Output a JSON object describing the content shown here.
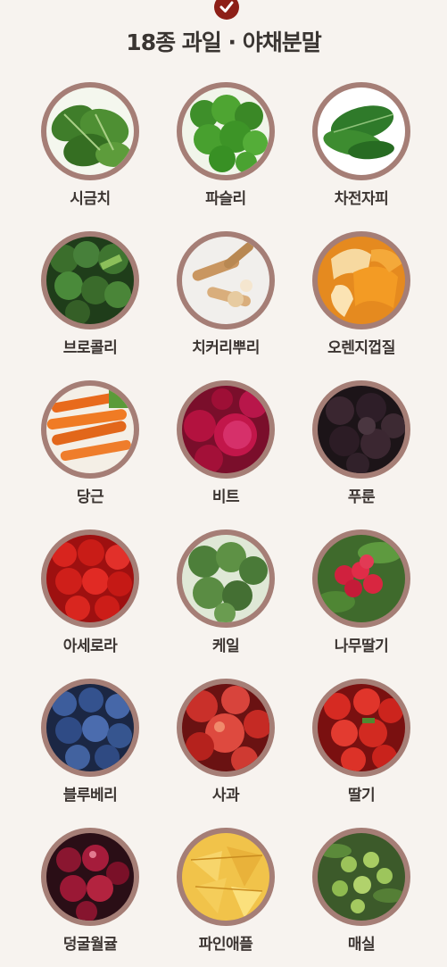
{
  "header": {
    "title": "18종 과일 · 야채분말",
    "check_icon": "check-circle-icon",
    "accent": "#8d1f17"
  },
  "items": [
    {
      "label": "시금치",
      "icon": "spinach-icon"
    },
    {
      "label": "파슬리",
      "icon": "parsley-icon"
    },
    {
      "label": "차전자피",
      "icon": "psyllium-icon"
    },
    {
      "label": "브로콜리",
      "icon": "broccoli-icon"
    },
    {
      "label": "치커리뿌리",
      "icon": "chicory-root-icon"
    },
    {
      "label": "오렌지껍질",
      "icon": "orange-peel-icon"
    },
    {
      "label": "당근",
      "icon": "carrot-icon"
    },
    {
      "label": "비트",
      "icon": "beet-icon"
    },
    {
      "label": "푸룬",
      "icon": "prune-icon"
    },
    {
      "label": "아세로라",
      "icon": "acerola-icon"
    },
    {
      "label": "케일",
      "icon": "kale-icon"
    },
    {
      "label": "나무딸기",
      "icon": "raspberry-icon"
    },
    {
      "label": "블루베리",
      "icon": "blueberry-icon"
    },
    {
      "label": "사과",
      "icon": "apple-icon"
    },
    {
      "label": "딸기",
      "icon": "strawberry-icon"
    },
    {
      "label": "덩굴월귤",
      "icon": "cranberry-icon"
    },
    {
      "label": "파인애플",
      "icon": "pineapple-icon"
    },
    {
      "label": "매실",
      "icon": "plum-icon"
    }
  ]
}
